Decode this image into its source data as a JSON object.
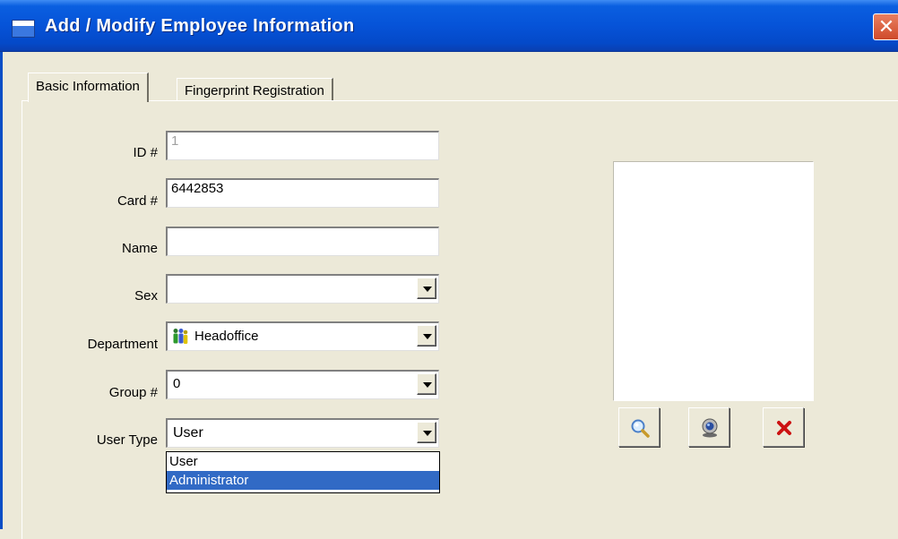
{
  "window": {
    "title": "Add / Modify Employee Information",
    "close_glyph": "✕"
  },
  "tabs": [
    {
      "label": "Basic Information",
      "active": true
    },
    {
      "label": "Fingerprint Registration",
      "active": false
    }
  ],
  "form": {
    "id": {
      "label": "ID #",
      "value": "1"
    },
    "card": {
      "label": "Card #",
      "value": "6442853"
    },
    "name": {
      "label": "Name",
      "value": ""
    },
    "sex": {
      "label": "Sex",
      "value": ""
    },
    "department": {
      "label": "Department",
      "value": "Headoffice",
      "icon": "group-people-icon"
    },
    "group": {
      "label": "Group #",
      "value": "0"
    },
    "user_type": {
      "label": "User Type",
      "value": "User",
      "options": [
        "User",
        "Administrator"
      ],
      "highlighted": "Administrator"
    }
  },
  "photo_tools": [
    {
      "name": "search-photo-button",
      "icon": "magnifier-icon"
    },
    {
      "name": "capture-photo-button",
      "icon": "webcam-icon"
    },
    {
      "name": "delete-photo-button",
      "icon": "red-x-icon"
    }
  ],
  "colors": {
    "title_bar": "#0653d8",
    "dialog_bg": "#ece9d8",
    "selection": "#316ac5",
    "delete_red": "#cc1111"
  }
}
